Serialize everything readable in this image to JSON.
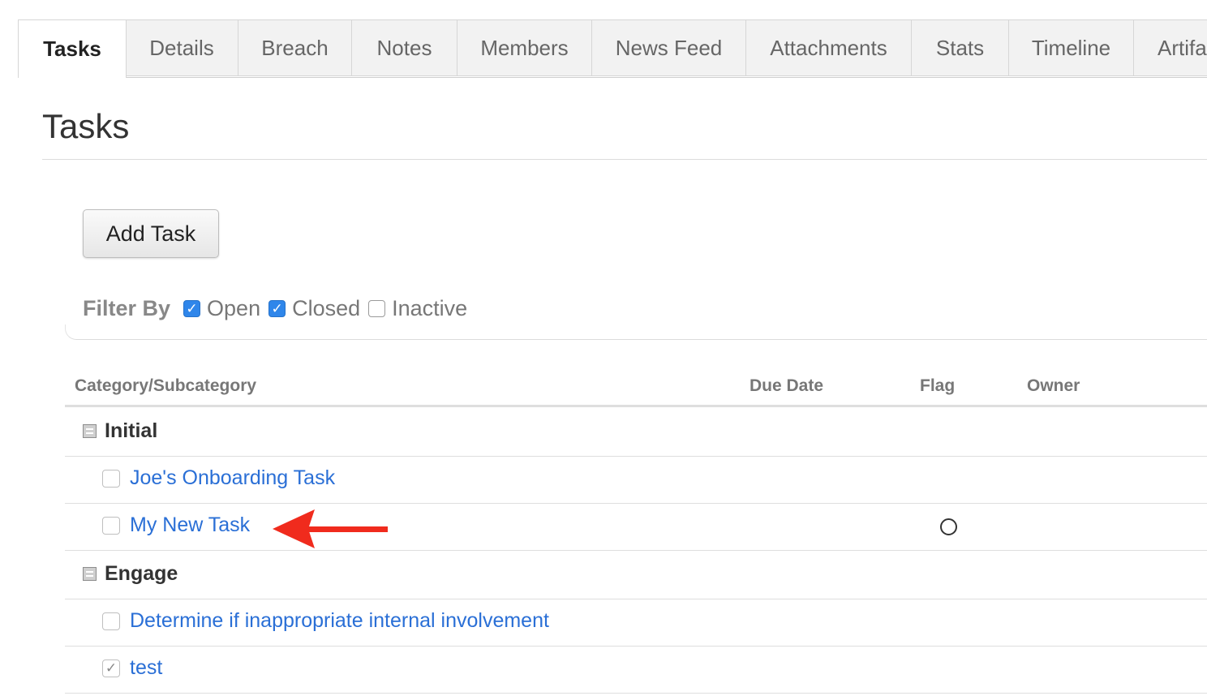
{
  "tabs": [
    {
      "label": "Tasks",
      "active": true
    },
    {
      "label": "Details"
    },
    {
      "label": "Breach"
    },
    {
      "label": "Notes"
    },
    {
      "label": "Members"
    },
    {
      "label": "News Feed"
    },
    {
      "label": "Attachments"
    },
    {
      "label": "Stats"
    },
    {
      "label": "Timeline"
    },
    {
      "label": "Artifa"
    }
  ],
  "page": {
    "title": "Tasks"
  },
  "actions": {
    "add_task": "Add Task"
  },
  "filter": {
    "label": "Filter By",
    "options": [
      {
        "label": "Open",
        "checked": true
      },
      {
        "label": "Closed",
        "checked": true
      },
      {
        "label": "Inactive",
        "checked": false
      }
    ]
  },
  "table": {
    "columns": [
      "Category/Subcategory",
      "Due Date",
      "Flag",
      "Owner"
    ],
    "categories": [
      {
        "name": "Initial",
        "tasks": [
          {
            "name": "Joe's Onboarding Task",
            "completed": false
          },
          {
            "name": "My New Task",
            "completed": false,
            "flag": "circle"
          }
        ]
      },
      {
        "name": "Engage",
        "tasks": [
          {
            "name": "Determine if inappropriate internal involvement",
            "completed": false
          },
          {
            "name": "test",
            "completed": true
          }
        ]
      }
    ]
  },
  "annotation": {
    "arrow_color": "#f02b1d"
  },
  "colors": {
    "link": "#2a6fd6",
    "checkbox_accent": "#2f86ea"
  }
}
